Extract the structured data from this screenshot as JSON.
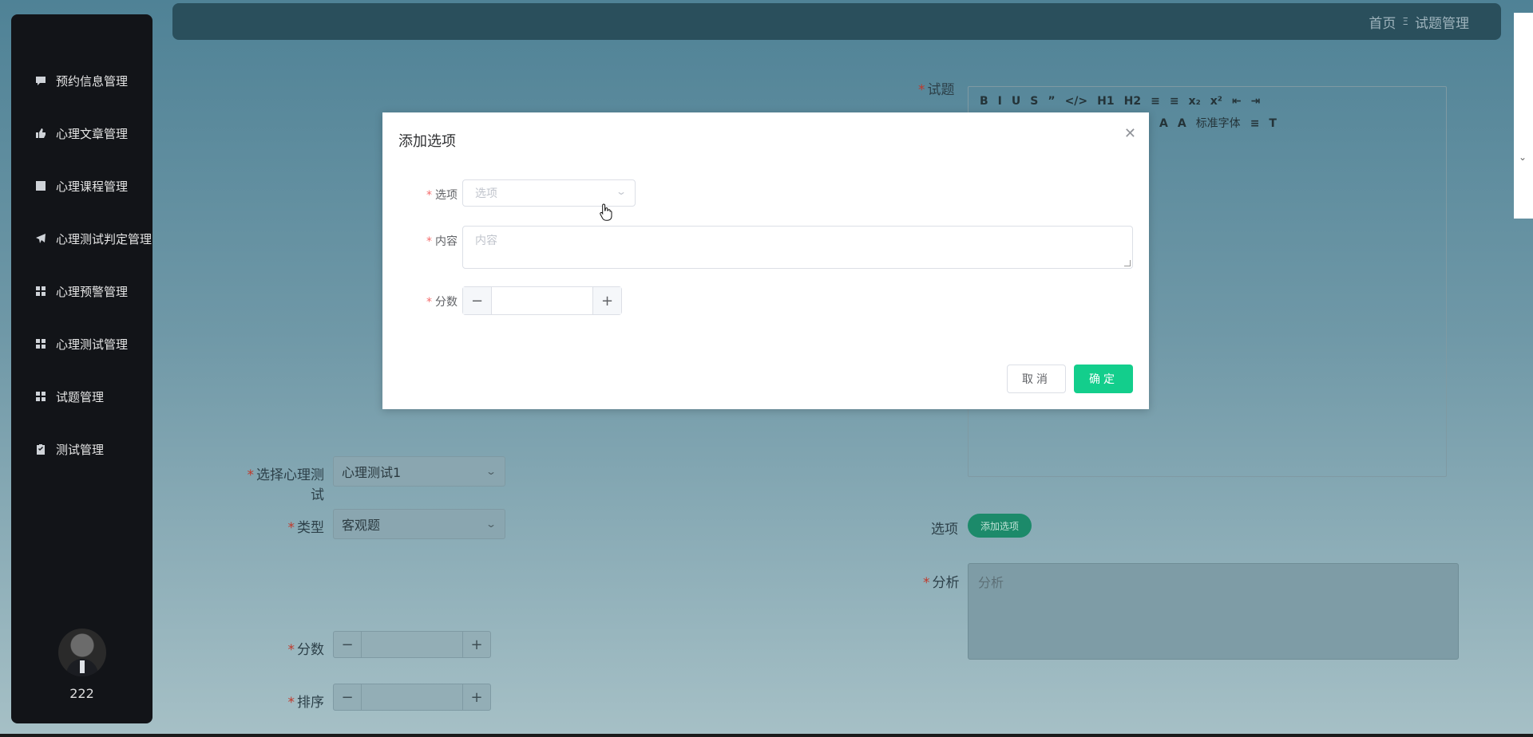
{
  "sidebar": {
    "items": [
      {
        "label": "预约信息管理",
        "icon": "comment-icon"
      },
      {
        "label": "心理文章管理",
        "icon": "thumb-icon"
      },
      {
        "label": "心理课程管理",
        "icon": "chart-icon"
      },
      {
        "label": "心理测试判定管理",
        "icon": "send-icon"
      },
      {
        "label": "心理预警管理",
        "icon": "grid-icon"
      },
      {
        "label": "心理测试管理",
        "icon": "grid-icon"
      },
      {
        "label": "试题管理",
        "icon": "grid-icon"
      },
      {
        "label": "测试管理",
        "icon": "clipboard-icon"
      }
    ],
    "username": "222"
  },
  "header": {
    "breadcrumb_home": "首页",
    "breadcrumb_sep": "Ξ",
    "breadcrumb_current": "试题管理"
  },
  "form": {
    "question_label": "试题",
    "test_select_label": "选择心理测试",
    "test_select_value": "心理测试1",
    "type_label": "类型",
    "type_value": "客观题",
    "score_label": "分数",
    "sort_label": "排序",
    "options_label": "选项",
    "add_option_button": "添加选项",
    "analysis_label": "分析",
    "analysis_placeholder": "分析",
    "editor_font": "标准字体"
  },
  "modal": {
    "title": "添加选项",
    "option_label": "选项",
    "option_placeholder": "选项",
    "content_label": "内容",
    "content_placeholder": "内容",
    "score_label": "分数",
    "cancel_label": "取消",
    "confirm_label": "确定"
  },
  "colors": {
    "confirm": "#13ce8c",
    "sidebar": "#121418",
    "required": "#f56c6c"
  }
}
